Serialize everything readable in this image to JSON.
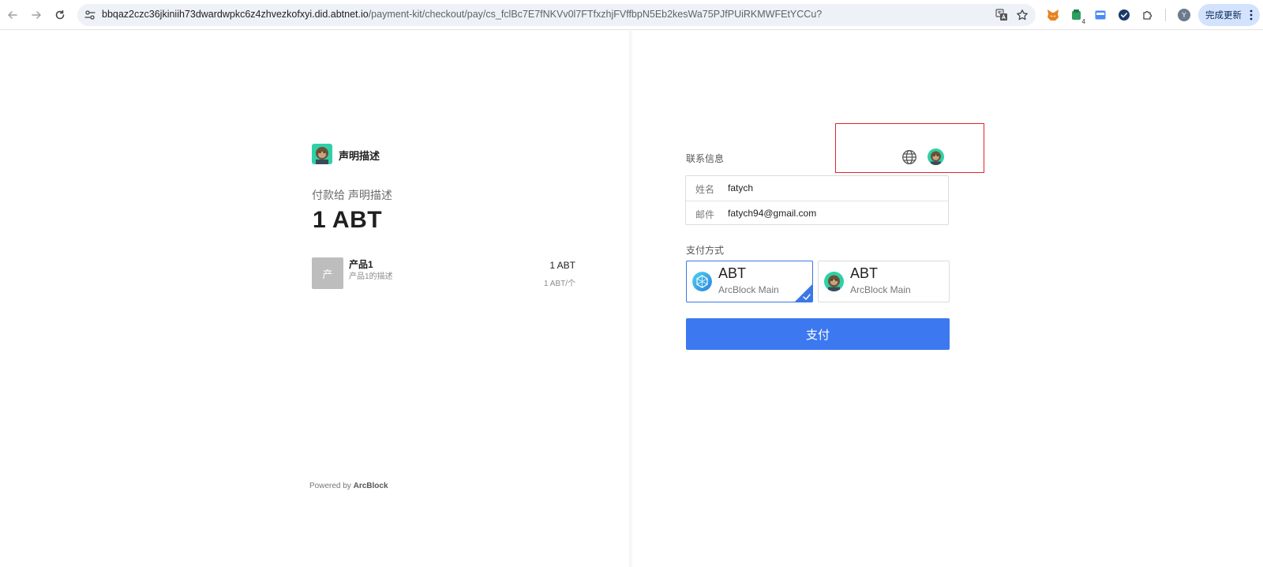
{
  "browser": {
    "url_host": "bbqaz2czc36jkiniih73dwardwpkc6z4zhvezkofxyi.did.abtnet.io",
    "url_path": "/payment-kit/checkout/pay/cs_fclBc7E7fNKVv0l7FTfxzhjFVffbpN5Eb2kesWa75PJfPUiRKMWFEtYCCu?",
    "profile_initial": "Y",
    "update_label": "完成更新",
    "extension_badge": "4"
  },
  "merchant": {
    "name": "声明描述",
    "pay_to": "付款给 声明描述",
    "amount": "1 ABT"
  },
  "product": {
    "thumb_char": "产",
    "name": "产品1",
    "description": "产品1的描述",
    "price": "1 ABT",
    "unit_price": "1 ABT/个"
  },
  "footer": {
    "powered_by": "Powered by",
    "brand": "ArcBlock"
  },
  "contact": {
    "label": "联系信息",
    "name_key": "姓名",
    "name_value": "fatych",
    "email_key": "邮件",
    "email_value": "fatych94@gmail.com"
  },
  "payment": {
    "label": "支付方式",
    "methods": [
      {
        "title": "ABT",
        "network": "ArcBlock Main",
        "selected": true
      },
      {
        "title": "ABT",
        "network": "ArcBlock Main",
        "selected": false
      }
    ],
    "pay_label": "支付"
  },
  "colors": {
    "accent": "#3c78f0",
    "highlight": "#e0262c",
    "selected_border": "#3b77e7"
  }
}
